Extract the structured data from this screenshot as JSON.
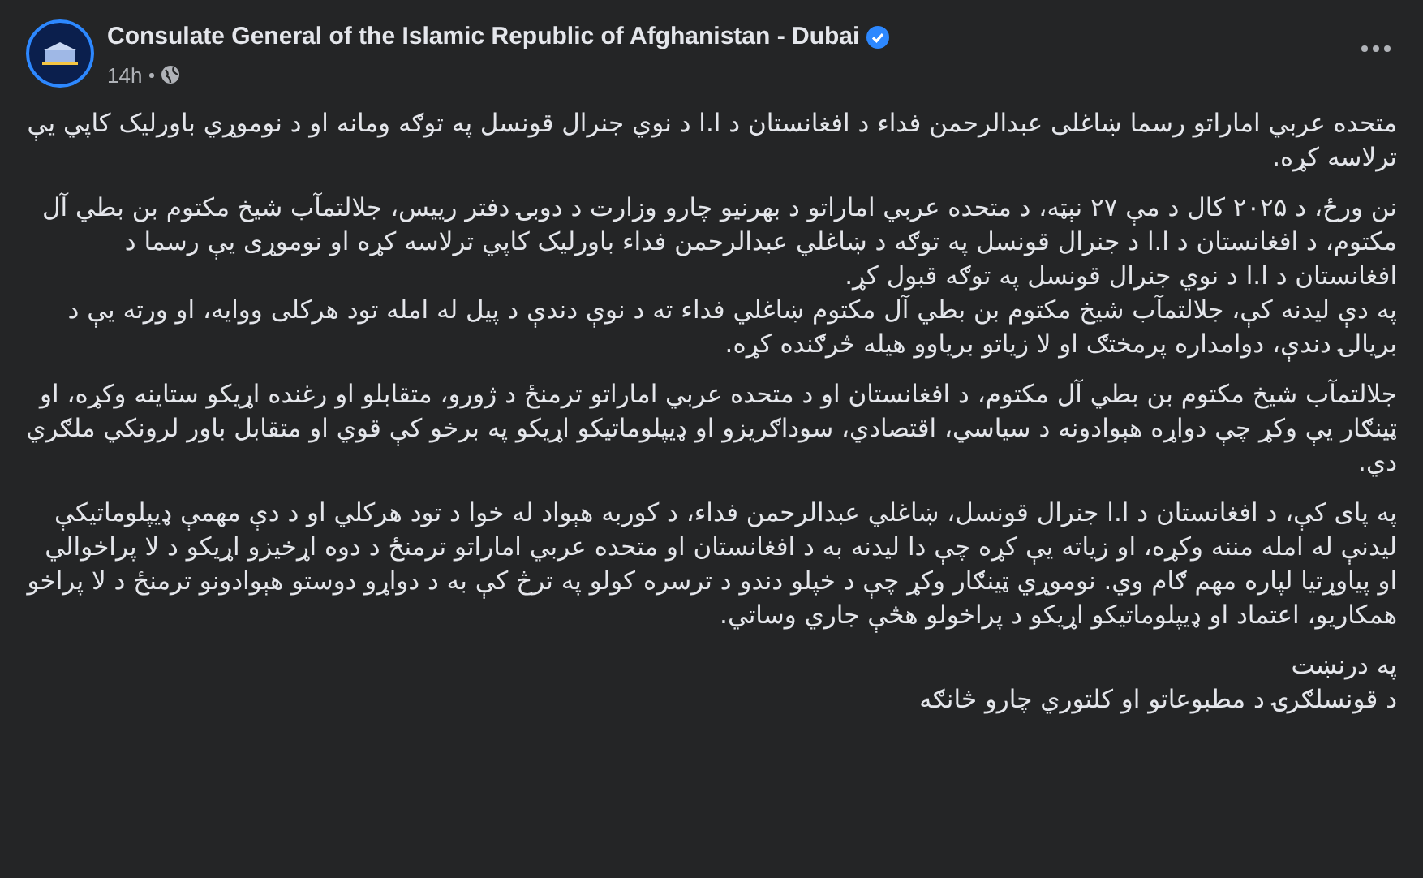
{
  "post": {
    "author": "Consulate General of the Islamic Republic of Afghanistan - Dubai",
    "verified": true,
    "time": "14h",
    "paragraphs": [
      [
        "متحده عربي اماراتو رسما ښاغلی عبدالرحمن فداء د افغانستان د ا.ا د نوي جنرال قونسل په توګه ومانه او د نوموړي باورلیک کاپي یې ترلاسه کړه."
      ],
      [
        "نن ورځ، د ۲۰۲۵ کال د مې ۲۷ نېټه، د متحده عربي اماراتو د بهرنیو چارو وزارت د دوبۍ دفتر رییس، جلالتمآب شیخ مکتوم بن بطي آل مکتوم، د افغانستان د ا.ا د جنرال قونسل په توګه د ښاغلي عبدالرحمن فداء باورلیک کاپي ترلاسه کړه او نوموړی یې رسما د افغانستان د ا.ا د نوي جنرال قونسل په توګه قبول کړ.",
        "په دې لیدنه کې، جلالتمآب شیخ مکتوم بن بطي آل مکتوم ښاغلي فداء ته د نوې دندې د پیل له امله تود هرکلی ووایه، او ورته یې د بریالۍ دندې، دوامداره پرمختګ او لا زیاتو بریاوو هیله څرګنده کړه."
      ],
      [
        "جلالتمآب شیخ مکتوم بن بطي آل مکتوم، د افغانستان او د متحده عربي اماراتو ترمنځ د ژورو، متقابلو او رغنده اړیکو ستاینه وکړه، او ټینګار یې وکړ چې دواړه هېوادونه د سیاسي، اقتصادي، سوداګریزو او ډیپلوماتیکو اړیکو په برخو کې قوي او متقابل باور لرونکي ملګري دي."
      ],
      [
        "په پای کې، د افغانستان د ا.ا جنرال قونسل، ښاغلي عبدالرحمن فداء، د کوربه هېواد له خوا د تود هرکلي او د دې مهمې ډیپلوماتیکې لیدنې له امله مننه وکړه، او زیاته یې کړه چې دا لیدنه به د افغانستان او متحده عربي اماراتو ترمنځ د دوه اړخیزو اړیکو د لا پراخوالي او پیاوړتیا لپاره مهم ګام وي. نوموړي ټینګار وکړ چې د خپلو دندو د ترسره کولو په ترڅ کې به د دواړو دوستو هېوادونو ترمنځ د لا پراخو همکاریو، اعتماد او ډیپلوماتیکو اړیکو د پراخولو هڅې جاري وساتي."
      ],
      [
        "په درنښت",
        "د قونسلګرۍ د مطبوعاتو او کلتوري چارو څانګه"
      ]
    ]
  }
}
